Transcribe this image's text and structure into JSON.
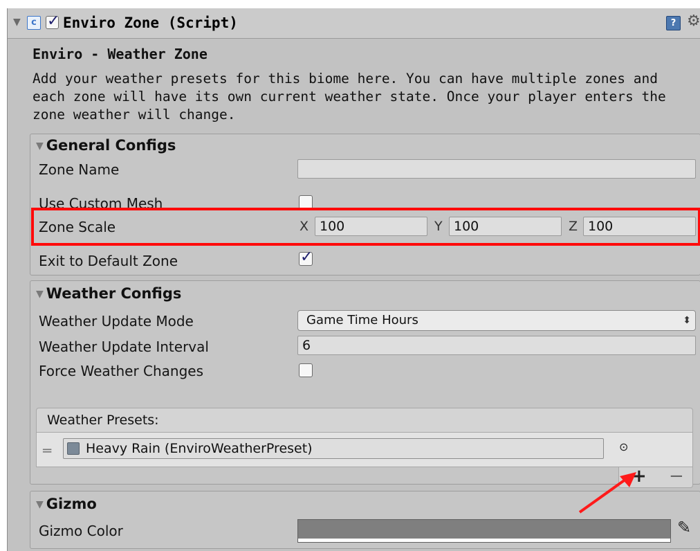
{
  "component": {
    "title": "Enviro Zone (Script)",
    "enabled": true
  },
  "zone": {
    "heading": "Enviro - Weather Zone",
    "description": "Add your weather presets for this biome here. You can have multiple zones and each zone will have its own current weather state. Once your player enters the zone weather will change."
  },
  "general": {
    "title": "General Configs",
    "zone_name_label": "Zone Name",
    "zone_name_value": "",
    "use_custom_mesh_label": "Use Custom Mesh",
    "use_custom_mesh": false,
    "zone_scale_label": "Zone Scale",
    "scale": {
      "x_label": "X",
      "x": "100",
      "y_label": "Y",
      "y": "100",
      "z_label": "Z",
      "z": "100"
    },
    "exit_default_label": "Exit to Default Zone",
    "exit_default": true
  },
  "weather": {
    "title": "Weather Configs",
    "update_mode_label": "Weather Update Mode",
    "update_mode_value": "Game Time Hours",
    "update_interval_label": "Weather Update Interval",
    "update_interval_value": "6",
    "force_changes_label": "Force Weather Changes",
    "force_changes": false,
    "presets_header": "Weather Presets:",
    "presets": [
      {
        "name": "Heavy Rain (EnviroWeatherPreset)"
      }
    ]
  },
  "gizmo": {
    "title": "Gizmo",
    "color_label": "Gizmo Color",
    "color": "#7f7f7f"
  },
  "annotation": {
    "highlight_color": "#ff0a0a"
  }
}
